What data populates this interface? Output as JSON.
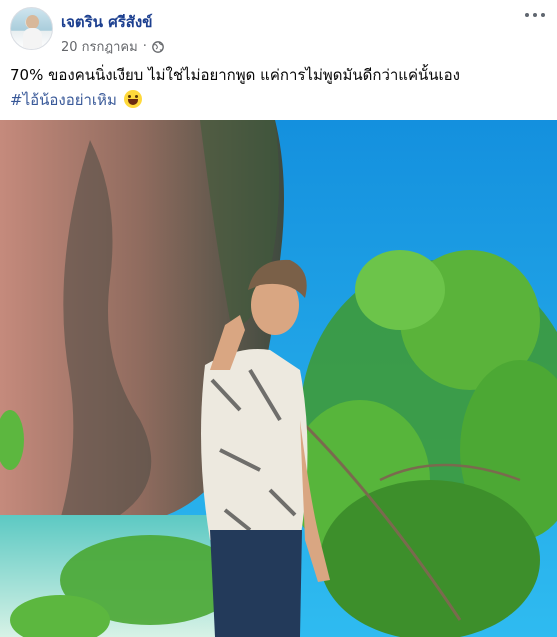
{
  "post": {
    "author_name": "เจตริน ศรีสังข์",
    "date": "20 กรกฎาคม",
    "separator": "·",
    "text": "70% ของคนนิ่งเงียบ ไม่ใช่ไม่อยากพูด แค่การไม่พูดมันดีกว่าแค่นั้นเอง",
    "hashtag": "#ไอ้น้องอย่าเหิม",
    "emoji_icon": "grinning-face-icon",
    "privacy_icon": "globe-icon"
  },
  "colors": {
    "author": "#1c3f8f",
    "hashtag": "#385898",
    "meta": "#65676b",
    "sky": "#1aa4e8",
    "sea": "#9ee3d9"
  }
}
